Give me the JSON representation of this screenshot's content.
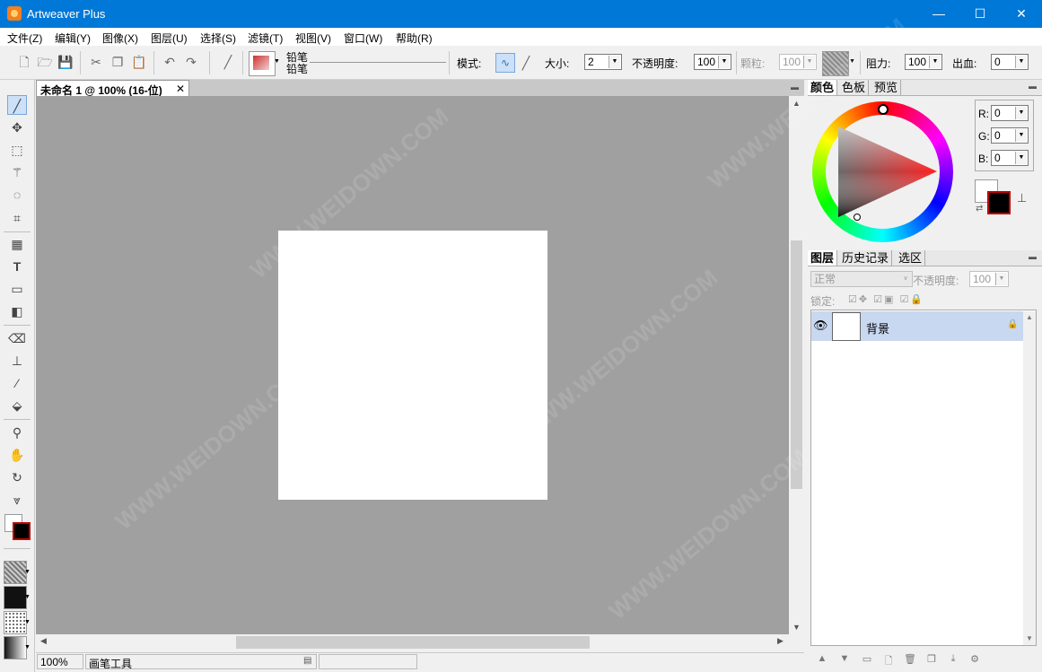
{
  "window": {
    "title": "Artweaver Plus",
    "controls": {
      "minimize": "—",
      "maximize": "☐",
      "close": "✕"
    }
  },
  "menu": [
    "文件(Z)",
    "编辑(Y)",
    "图像(X)",
    "图层(U)",
    "选择(S)",
    "滤镜(T)",
    "视图(V)",
    "窗口(W)",
    "帮助(R)"
  ],
  "toolbar": {
    "brush_name_1": "铅笔",
    "brush_name_2": "铅笔",
    "mode_label": "模式:",
    "size_label": "大小:",
    "size_value": "2",
    "opacity_label": "不透明度:",
    "opacity_value": "100",
    "grain_label": "颗粒:",
    "grain_value": "100",
    "resist_label": "阻力:",
    "resist_value": "100",
    "bleed_label": "出血:",
    "bleed_value": "0"
  },
  "document": {
    "tab_title": "未命名 1 @ 100% (16-位)",
    "close": "✕",
    "zoom": "100%",
    "status_tool": "画笔工具"
  },
  "color_panel": {
    "tabs": [
      "颜色",
      "色板",
      "预览"
    ],
    "r_label": "R:",
    "r_value": "0",
    "g_label": "G:",
    "g_value": "0",
    "b_label": "B:",
    "b_value": "0",
    "foreground": "#000000",
    "background": "#ffffff"
  },
  "layer_panel": {
    "tabs": [
      "图层",
      "历史记录",
      "选区"
    ],
    "blend_mode": "正常",
    "opacity_label": "不透明度:",
    "opacity_value": "100",
    "lock_label": "锁定:",
    "layer_name": "背景"
  },
  "watermark": "WWW.WEIDOWN.COM",
  "colors": {
    "titlebar": "#0078d7",
    "canvas_bg": "#a0a0a0",
    "selected_layer": "#c8d8f0"
  }
}
